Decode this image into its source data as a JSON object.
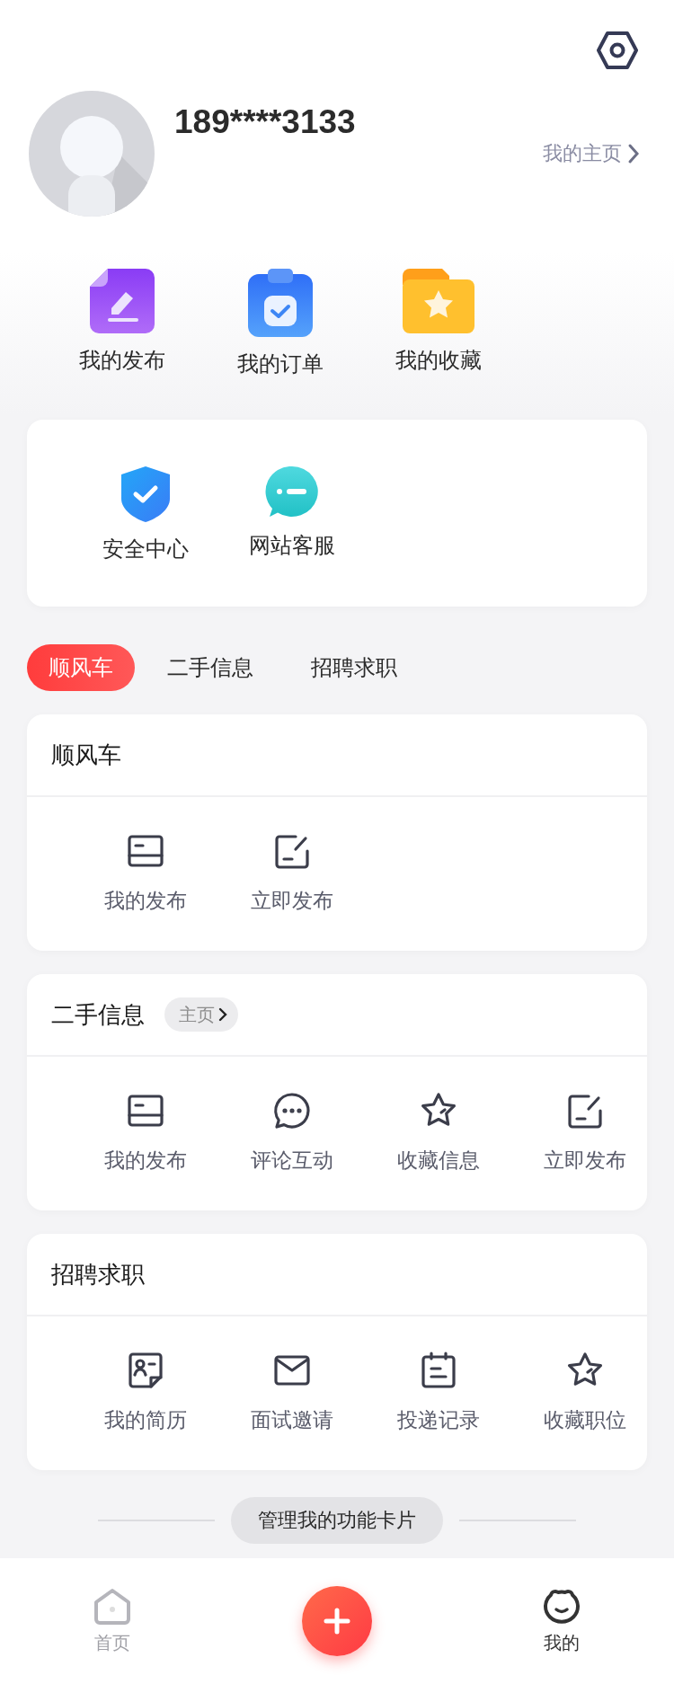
{
  "header": {
    "phone": "189****3133",
    "homepage_link": "我的主页"
  },
  "quick_actions": [
    {
      "label": "我的发布",
      "kind": "publish"
    },
    {
      "label": "我的订单",
      "kind": "order"
    },
    {
      "label": "我的收藏",
      "kind": "favorite"
    }
  ],
  "services": [
    {
      "label": "安全中心",
      "kind": "shield"
    },
    {
      "label": "网站客服",
      "kind": "chat"
    }
  ],
  "tabs": [
    {
      "label": "顺风车",
      "selected": true
    },
    {
      "label": "二手信息",
      "selected": false
    },
    {
      "label": "招聘求职",
      "selected": false
    }
  ],
  "sections": [
    {
      "title": "顺风车",
      "items": [
        {
          "label": "我的发布",
          "kind": "list"
        },
        {
          "label": "立即发布",
          "kind": "edit"
        }
      ]
    },
    {
      "title": "二手信息",
      "badge": "主页",
      "items": [
        {
          "label": "我的发布",
          "kind": "list"
        },
        {
          "label": "评论互动",
          "kind": "comment"
        },
        {
          "label": "收藏信息",
          "kind": "star"
        },
        {
          "label": "立即发布",
          "kind": "edit"
        }
      ]
    },
    {
      "title": "招聘求职",
      "items": [
        {
          "label": "我的简历",
          "kind": "resume"
        },
        {
          "label": "面试邀请",
          "kind": "mail"
        },
        {
          "label": "投递记录",
          "kind": "calendar"
        },
        {
          "label": "收藏职位",
          "kind": "star"
        }
      ]
    }
  ],
  "manage_button": "管理我的功能卡片",
  "bottom_nav": [
    {
      "label": "首页",
      "kind": "home",
      "selected": false
    },
    {
      "kind": "add"
    },
    {
      "label": "我的",
      "kind": "me",
      "selected": true
    }
  ]
}
